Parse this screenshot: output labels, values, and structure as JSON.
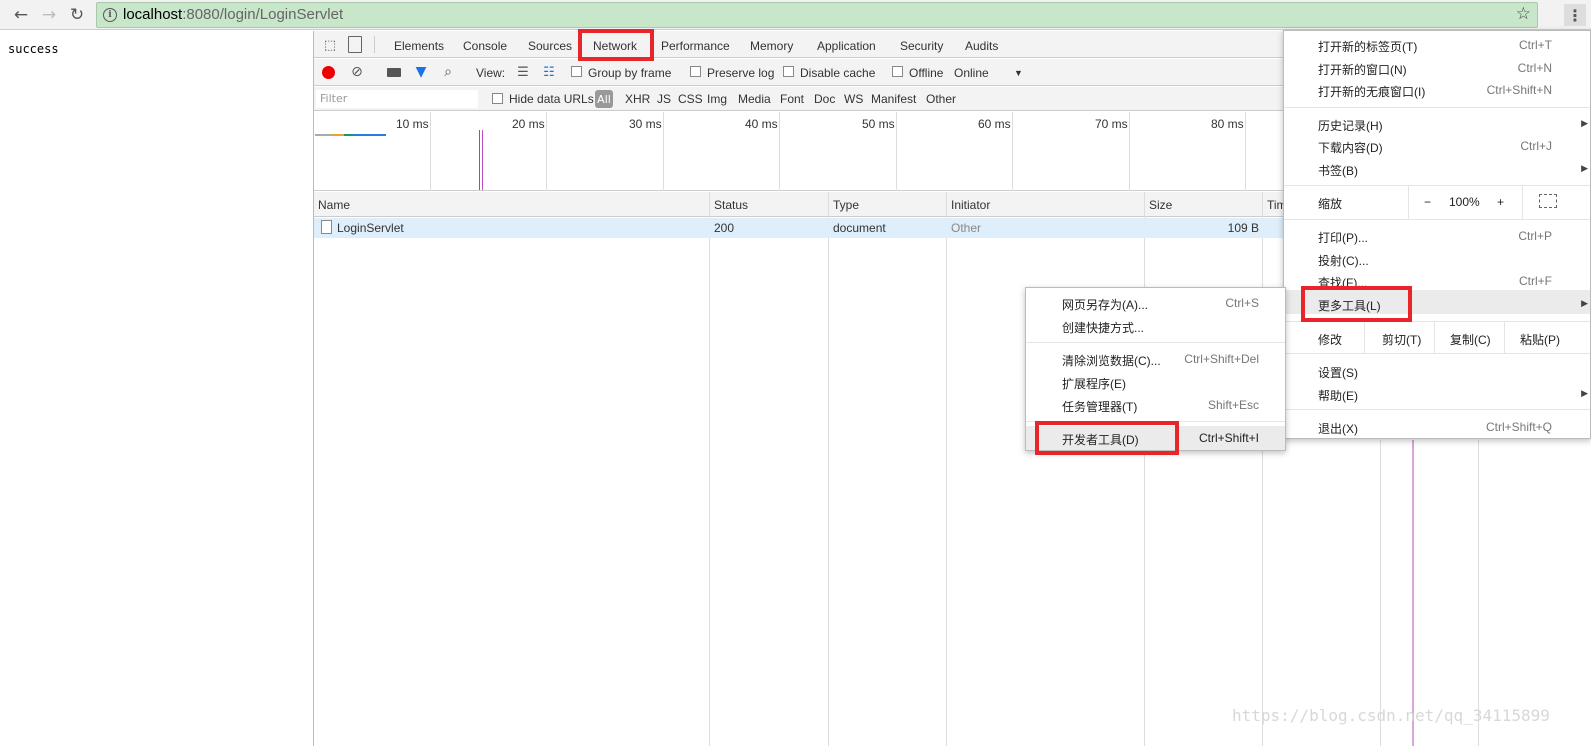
{
  "browser": {
    "url_host": "localhost",
    "url_rest": ":8080/login/LoginServlet"
  },
  "page": {
    "body_text": "success"
  },
  "devtools": {
    "tabs": [
      "Elements",
      "Console",
      "Sources",
      "Network",
      "Performance",
      "Memory",
      "Application",
      "Security",
      "Audits"
    ],
    "active_tab": "Network",
    "toolbar": {
      "view_label": "View:",
      "group_by_frame": "Group by frame",
      "preserve_log": "Preserve log",
      "disable_cache": "Disable cache",
      "offline": "Offline",
      "throttle": "Online"
    },
    "filter": {
      "placeholder": "Filter",
      "hide_data_urls": "Hide data URLs",
      "types": [
        "All",
        "XHR",
        "JS",
        "CSS",
        "Img",
        "Media",
        "Font",
        "Doc",
        "WS",
        "Manifest",
        "Other"
      ]
    },
    "timeline_ticks": [
      "10 ms",
      "20 ms",
      "30 ms",
      "40 ms",
      "50 ms",
      "60 ms",
      "70 ms",
      "80 ms"
    ],
    "columns": [
      "Name",
      "Status",
      "Type",
      "Initiator",
      "Size",
      "Tim"
    ],
    "rows": [
      {
        "name": "LoginServlet",
        "status": "200",
        "type": "document",
        "initiator": "Other",
        "size": "109 B"
      }
    ]
  },
  "main_menu": {
    "new_tab": "打开新的标签页(T)",
    "new_tab_sc": "Ctrl+T",
    "new_window": "打开新的窗口(N)",
    "new_window_sc": "Ctrl+N",
    "incognito": "打开新的无痕窗口(I)",
    "incognito_sc": "Ctrl+Shift+N",
    "history": "历史记录(H)",
    "downloads": "下载内容(D)",
    "downloads_sc": "Ctrl+J",
    "bookmarks": "书签(B)",
    "zoom": "缩放",
    "zoom_minus": "−",
    "zoom_value": "100%",
    "zoom_plus": "+",
    "print": "打印(P)...",
    "print_sc": "Ctrl+P",
    "cast": "投射(C)...",
    "find": "查找(F)...",
    "find_sc": "Ctrl+F",
    "more_tools": "更多工具(L)",
    "edit": "修改",
    "cut": "剪切(T)",
    "copy": "复制(C)",
    "paste": "粘贴(P)",
    "settings": "设置(S)",
    "help": "帮助(E)",
    "exit": "退出(X)",
    "exit_sc": "Ctrl+Shift+Q"
  },
  "sub_menu": {
    "save_page": "网页另存为(A)...",
    "save_page_sc": "Ctrl+S",
    "create_shortcut": "创建快捷方式...",
    "clear_data": "清除浏览数据(C)...",
    "clear_data_sc": "Ctrl+Shift+Del",
    "extensions": "扩展程序(E)",
    "task_manager": "任务管理器(T)",
    "task_manager_sc": "Shift+Esc",
    "dev_tools": "开发者工具(D)",
    "dev_tools_sc": "Ctrl+Shift+I"
  },
  "watermark": "https://blog.csdn.net/qq_34115899",
  "colors": {
    "highlight": "#e8252b",
    "omnibox": "#c8e6c9",
    "selected_row": "#dfeefb"
  }
}
